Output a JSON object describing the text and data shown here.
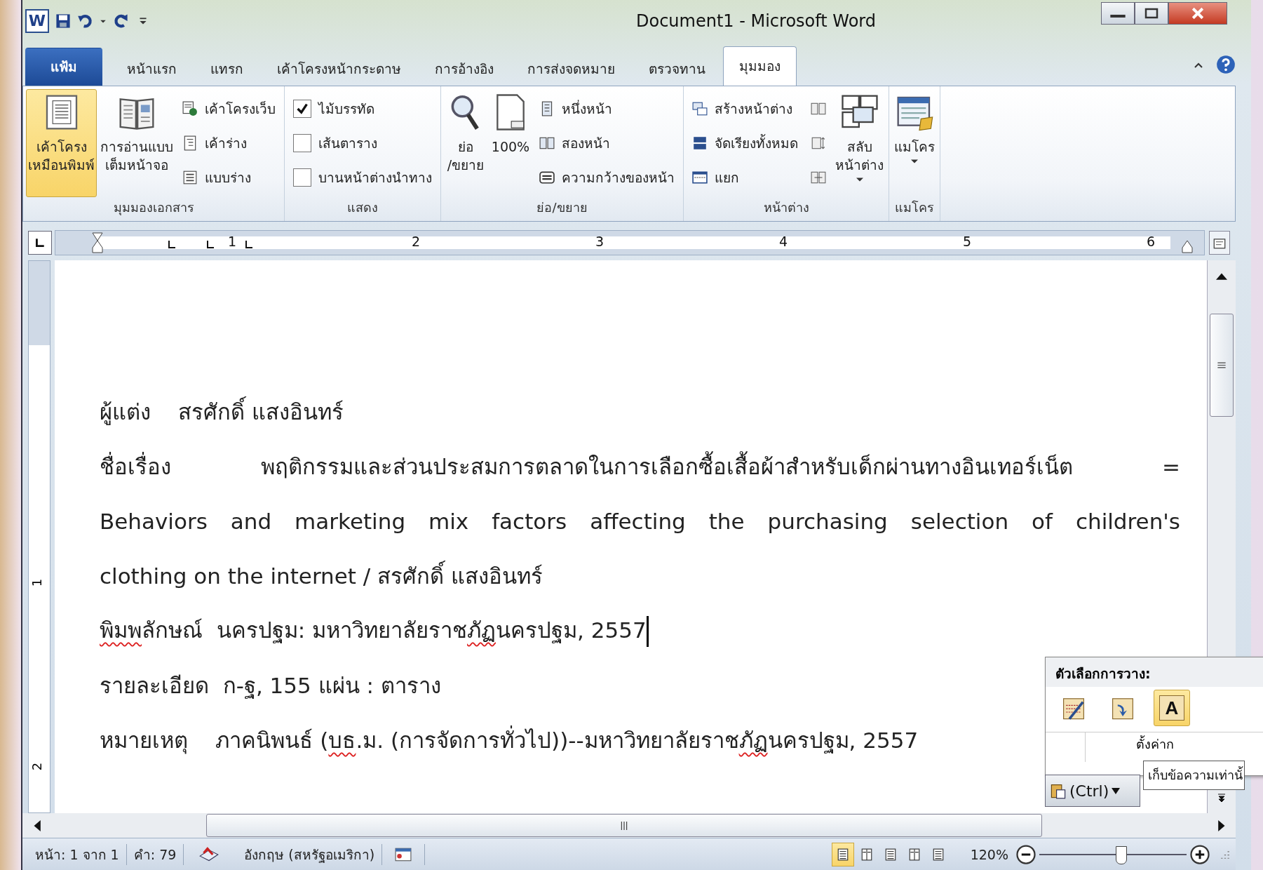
{
  "title_bar": {
    "logo_letter": "W",
    "title": "Document1 - Microsoft Word"
  },
  "tabs": [
    {
      "label": "แฟ้ม",
      "kind": "file",
      "selected": false
    },
    {
      "label": "หน้าแรก",
      "kind": "tab",
      "selected": false
    },
    {
      "label": "แทรก",
      "kind": "tab",
      "selected": false
    },
    {
      "label": "เค้าโครงหน้ากระดาษ",
      "kind": "tab",
      "selected": false
    },
    {
      "label": "การอ้างอิง",
      "kind": "tab",
      "selected": false
    },
    {
      "label": "การส่งจดหมาย",
      "kind": "tab",
      "selected": false
    },
    {
      "label": "ตรวจทาน",
      "kind": "tab",
      "selected": false
    },
    {
      "label": "มุมมอง",
      "kind": "tab",
      "selected": true
    }
  ],
  "ribbon_groups": [
    {
      "label": "มุมมองเอกสาร",
      "columns": [
        {
          "kind": "large",
          "label": "เค้าโครง\nเหมือนพิมพ์",
          "selected": true
        },
        {
          "kind": "large",
          "label": "การอ่านแบบ\nเต็มหน้าจอ",
          "selected": false
        },
        {
          "kind": "stack",
          "items": [
            {
              "kind": "small",
              "label": "เค้าโครงเว็บ"
            },
            {
              "kind": "small",
              "label": "เค้าร่าง"
            },
            {
              "kind": "small",
              "label": "แบบร่าง"
            }
          ]
        }
      ]
    },
    {
      "label": "แสดง",
      "columns": [
        {
          "kind": "stack",
          "items": [
            {
              "kind": "checkbox",
              "label": "ไม้บรรทัด",
              "checked": true
            },
            {
              "kind": "checkbox",
              "label": "เส้นตาราง",
              "checked": false
            },
            {
              "kind": "checkbox",
              "label": "บานหน้าต่างนำทาง",
              "checked": false
            }
          ]
        }
      ]
    },
    {
      "label": "ย่อ/ขยาย",
      "columns": [
        {
          "kind": "large",
          "label": "ย่อ\n/ขยาย"
        },
        {
          "kind": "large",
          "label": "100%"
        },
        {
          "kind": "stack",
          "items": [
            {
              "kind": "small",
              "label": "หนึ่งหน้า"
            },
            {
              "kind": "small",
              "label": "สองหน้า"
            },
            {
              "kind": "small",
              "label": "ความกว้างของหน้า"
            }
          ]
        }
      ]
    },
    {
      "label": "หน้าต่าง",
      "columns": [
        {
          "kind": "stack",
          "items": [
            {
              "kind": "small",
              "label": "สร้างหน้าต่าง"
            },
            {
              "kind": "small",
              "label": "จัดเรียงทั้งหมด"
            },
            {
              "kind": "small",
              "label": "แยก"
            }
          ]
        },
        {
          "kind": "stack",
          "items": [
            {
              "kind": "icon"
            },
            {
              "kind": "icon"
            },
            {
              "kind": "icon"
            }
          ]
        },
        {
          "kind": "large",
          "label": "สลับ\nหน้าต่าง",
          "dropdown": true
        }
      ]
    },
    {
      "label": "แมโคร",
      "columns": [
        {
          "kind": "large",
          "label": "แมโคร",
          "dropdown": true
        }
      ]
    }
  ],
  "ruler_numbers": [
    "1",
    "2",
    "3",
    "4",
    "5",
    "6"
  ],
  "vruler_numbers": [
    "1",
    "2"
  ],
  "document_lines": [
    {
      "justified": false,
      "cursor": false,
      "segments": [
        {
          "text": "ผู้แต่ง    สรศักดิ์ แสงอินทร์",
          "misspelled": false
        }
      ]
    },
    {
      "justified": true,
      "cursor": false,
      "segments": [
        {
          "text": "ชื่อเรื่อง พฤติกรรมและส่วนประสมการตลาดในการเลือกซื้อเสื้อผ้าสำหรับเด็กผ่านทางอินเทอร์เน็ต =",
          "misspelled": false
        }
      ]
    },
    {
      "justified": true,
      "cursor": false,
      "segments": [
        {
          "text": "Behaviors and marketing mix factors affecting the purchasing selection of children's",
          "misspelled": false
        }
      ]
    },
    {
      "justified": false,
      "cursor": false,
      "segments": [
        {
          "text": "clothing on the internet / สรศักดิ์ แสงอินทร์",
          "misspelled": false
        }
      ]
    },
    {
      "justified": false,
      "cursor": true,
      "segments": [
        {
          "text": "พิมพ",
          "misspelled": true
        },
        {
          "text": "ลักษณ์  นครปฐม: มหาวิทยาลัยราช",
          "misspelled": false
        },
        {
          "text": "ภัฏ",
          "misspelled": true
        },
        {
          "text": "นครปฐม, 2557",
          "misspelled": false
        }
      ]
    },
    {
      "justified": false,
      "cursor": false,
      "segments": [
        {
          "text": "รายละเอียด  ก-ฐ, 155 แผ่น : ตาราง",
          "misspelled": false
        }
      ]
    },
    {
      "justified": false,
      "cursor": false,
      "segments": [
        {
          "text": "หมายเหตุ    ภาคนิพนธ์ (",
          "misspelled": false
        },
        {
          "text": "บธ",
          "misspelled": true
        },
        {
          "text": ".ม. (การจัดการทั่วไป))--มหาวิทยาลัยราช",
          "misspelled": false
        },
        {
          "text": "ภัฏ",
          "misspelled": true
        },
        {
          "text": "นครปฐม, 2557",
          "misspelled": false
        }
      ]
    }
  ],
  "paste_popup": {
    "title": "ตัวเลือกการวาง:",
    "options": [
      {
        "selected": false
      },
      {
        "selected": false
      },
      {
        "selected": true,
        "glyph": "A"
      }
    ],
    "set_default": "ตั้งค่าก",
    "button": "(Ctrl)",
    "tooltip": "เก็บข้อความเท่านั้"
  },
  "status_bar": {
    "page": "หน้า: 1 จาก 1",
    "words": "คำ: 79",
    "language": "อังกฤษ (สหรัฐอเมริกา)",
    "views": [
      {
        "selected": true
      },
      {
        "selected": false
      },
      {
        "selected": false
      },
      {
        "selected": false
      },
      {
        "selected": false
      }
    ],
    "zoom": "120%",
    "zoom_slider": {
      "level": 0.55
    }
  }
}
